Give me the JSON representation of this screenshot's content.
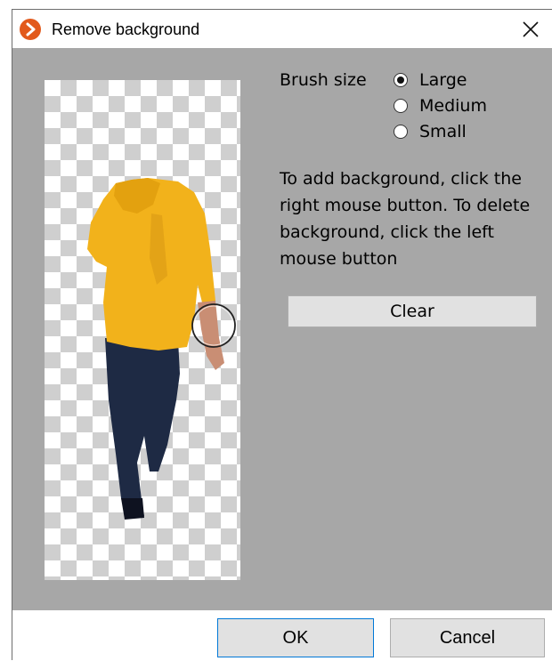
{
  "window": {
    "title": "Remove background"
  },
  "brush": {
    "label": "Brush size",
    "options": [
      {
        "label": "Large",
        "checked": true
      },
      {
        "label": "Medium",
        "checked": false
      },
      {
        "label": "Small",
        "checked": false
      }
    ]
  },
  "instructions": "To add background, click the right mouse button. To delete background, click the left mouse button",
  "clear_label": "Clear",
  "footer": {
    "ok_label": "OK",
    "cancel_label": "Cancel"
  },
  "colors": {
    "client_bg": "#a7a7a7",
    "accent": "#e25a1c",
    "ok_border": "#0078d7",
    "hoodie": "#f2b21b",
    "jeans": "#1e2a44"
  }
}
